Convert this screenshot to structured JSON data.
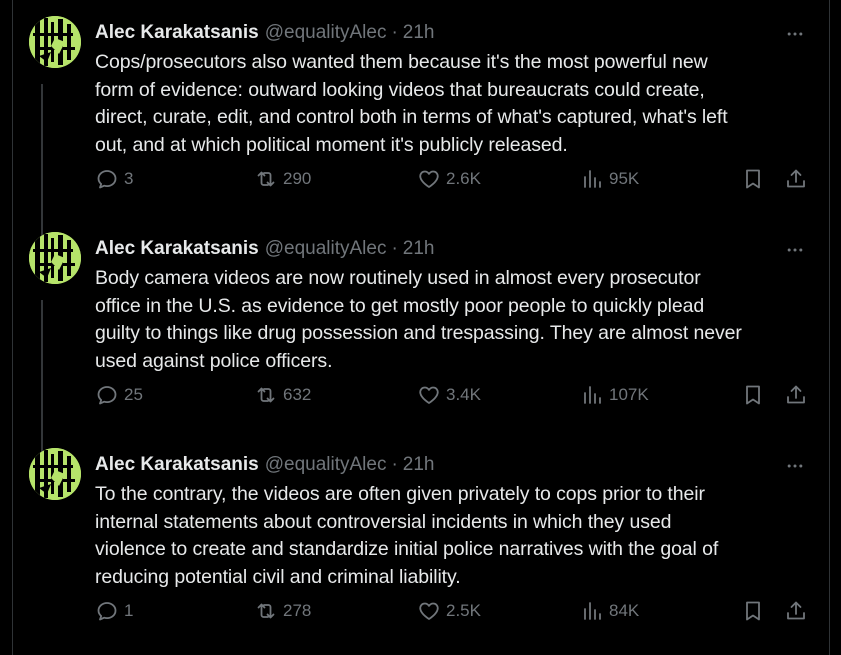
{
  "tweets": [
    {
      "author_name": "Alec Karakatsanis",
      "handle": "@equalityAlec",
      "separator": "·",
      "time": "21h",
      "text": "Cops/prosecutors also wanted them because it's the most powerful new\nform of evidence: outward looking videos that bureaucrats could create,\ndirect, curate, edit, and control both in terms of what's captured, what's left\nout, and at which political moment it's publicly released.",
      "replies": "3",
      "reposts": "290",
      "likes": "2.6K",
      "views": "95K"
    },
    {
      "author_name": "Alec Karakatsanis",
      "handle": "@equalityAlec",
      "separator": "·",
      "time": "21h",
      "text": "Body camera videos are now routinely used in almost every prosecutor\noffice in the U.S. as evidence to get mostly poor people to quickly plead\nguilty to things like drug possession and trespassing. They are almost never\nused against police officers.",
      "replies": "25",
      "reposts": "632",
      "likes": "3.4K",
      "views": "107K"
    },
    {
      "author_name": "Alec Karakatsanis",
      "handle": "@equalityAlec",
      "separator": "·",
      "time": "21h",
      "text": "To the contrary, the videos are often given privately to cops prior to their\ninternal statements about controversial incidents in which they used\nviolence to create and standardize initial police narratives with the goal of\nreducing potential civil and criminal liability.",
      "replies": "1",
      "reposts": "278",
      "likes": "2.5K",
      "views": "84K"
    }
  ],
  "icons": {
    "reply": "reply-icon",
    "repost": "repost-icon",
    "like": "heart-icon",
    "views": "views-icon",
    "bookmark": "bookmark-icon",
    "share": "share-icon",
    "more": "more-icon"
  },
  "colors": {
    "background": "#000000",
    "text": "#e7e9ea",
    "secondary": "#71767b",
    "avatar_accent": "#b6e36a"
  }
}
